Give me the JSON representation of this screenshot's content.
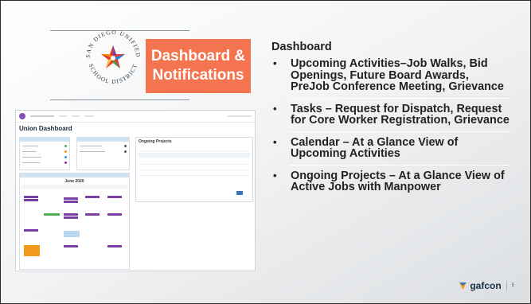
{
  "slide": {
    "banner": {
      "line1": "Dashboard &",
      "line2": "Notifications"
    },
    "logo": {
      "top_text": "SAN DIEGO UNIFIED",
      "bottom_text": "SCHOOL DISTRICT",
      "icon": "star-seal-icon"
    },
    "heading": "Dashboard",
    "bullets": [
      "Upcoming Activities–Job Walks, Bid Openings, Future Board Awards, PreJob Conference Meeting, Grievance",
      "Tasks – Request for Dispatch, Request for Core Worker Registration, Grievance",
      "Calendar – At a Glance View of Upcoming Activities",
      "Ongoing Projects – At a Glance View of Active Jobs with Manpower"
    ],
    "bullet_glyph": "•",
    "footer": {
      "brand": "gafcon",
      "page_number": "5"
    }
  },
  "screenshot": {
    "title": "Union Dashboard",
    "ongoing_title": "Ongoing Projects",
    "calendar_month": "June 2020"
  },
  "colors": {
    "banner": "#f4744f",
    "accent_blue": "#3a74b8",
    "calendar_purple": "#7b3fa3",
    "calendar_orange": "#f39a1e"
  }
}
